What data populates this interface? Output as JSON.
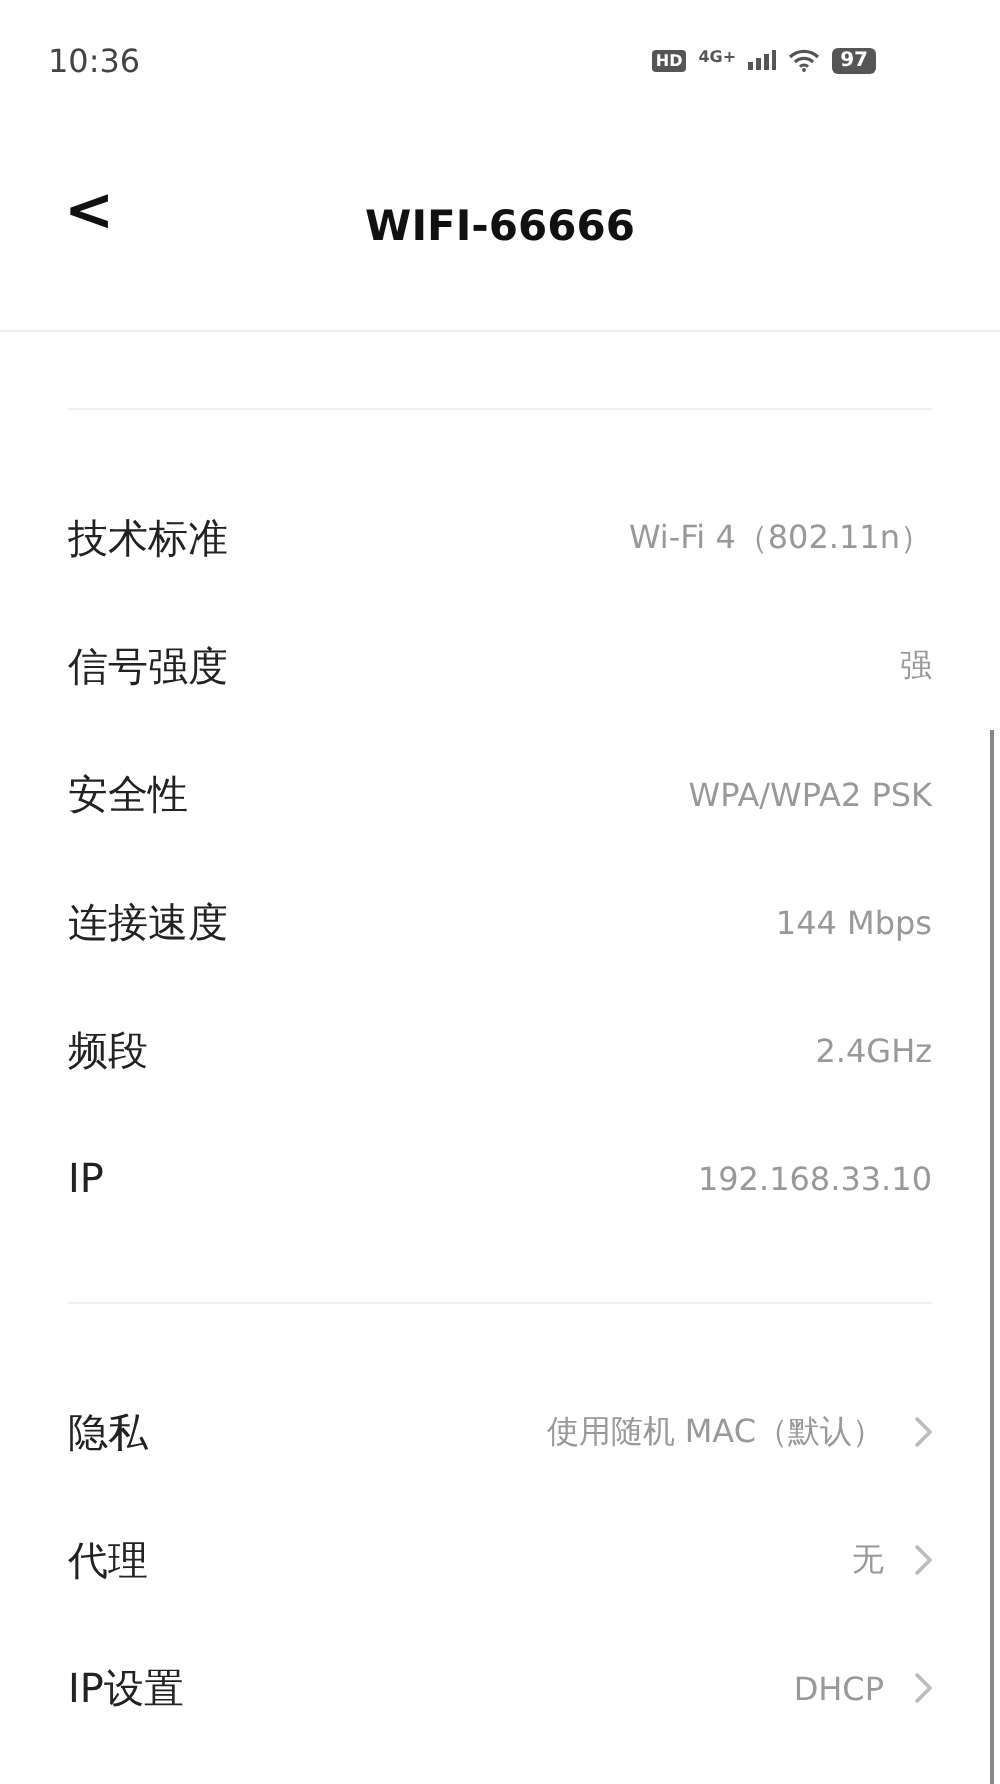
{
  "status_bar": {
    "time": "10:36",
    "hd": "HD",
    "network": "4G+",
    "battery": "97"
  },
  "header": {
    "back": "<",
    "title": "WIFI-66666"
  },
  "sections": [
    {
      "rows": [
        {
          "kind": "info",
          "label": "技术标准",
          "value": "Wi-Fi 4（802.11n）"
        },
        {
          "kind": "info",
          "label": "信号强度",
          "value": "强"
        },
        {
          "kind": "info",
          "label": "安全性",
          "value": "WPA/WPA2 PSK"
        },
        {
          "kind": "info",
          "label": "连接速度",
          "value": "144 Mbps"
        },
        {
          "kind": "info",
          "label": "频段",
          "value": "2.4GHz"
        },
        {
          "kind": "info",
          "label": "IP",
          "value": "192.168.33.10"
        }
      ]
    },
    {
      "rows": [
        {
          "kind": "link",
          "label": "隐私",
          "value": "使用随机 MAC（默认）"
        },
        {
          "kind": "link",
          "label": "代理",
          "value": "无"
        },
        {
          "kind": "link",
          "label": "IP设置",
          "value": "DHCP"
        }
      ]
    }
  ]
}
